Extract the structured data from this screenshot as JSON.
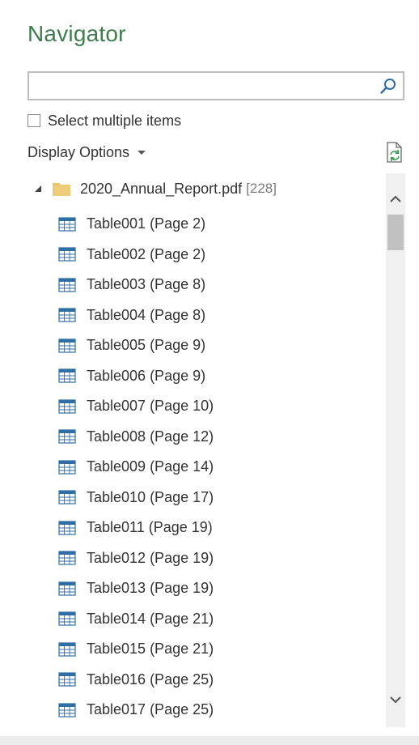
{
  "title": "Navigator",
  "search": {
    "value": "",
    "placeholder": ""
  },
  "select_multiple": {
    "label": "Select multiple items",
    "checked": false
  },
  "display_options": {
    "label": "Display Options"
  },
  "tree": {
    "root": {
      "name": "2020_Annual_Report.pdf",
      "count": "[228]",
      "expanded": true,
      "icon": "folder-icon"
    },
    "items": [
      {
        "label": "Table001 (Page 2)"
      },
      {
        "label": "Table002 (Page 2)"
      },
      {
        "label": "Table003 (Page 8)"
      },
      {
        "label": "Table004 (Page 8)"
      },
      {
        "label": "Table005 (Page 9)"
      },
      {
        "label": "Table006 (Page 9)"
      },
      {
        "label": "Table007 (Page 10)"
      },
      {
        "label": "Table008 (Page 12)"
      },
      {
        "label": "Table009 (Page 14)"
      },
      {
        "label": "Table010 (Page 17)"
      },
      {
        "label": "Table011 (Page 19)"
      },
      {
        "label": "Table012 (Page 19)"
      },
      {
        "label": "Table013 (Page 19)"
      },
      {
        "label": "Table014 (Page 21)"
      },
      {
        "label": "Table015 (Page 21)"
      },
      {
        "label": "Table016 (Page 25)"
      },
      {
        "label": "Table017 (Page 25)"
      }
    ]
  },
  "colors": {
    "title": "#3f7c4e",
    "table_icon": "#2f6ea5",
    "folder": "#e8c46a"
  }
}
